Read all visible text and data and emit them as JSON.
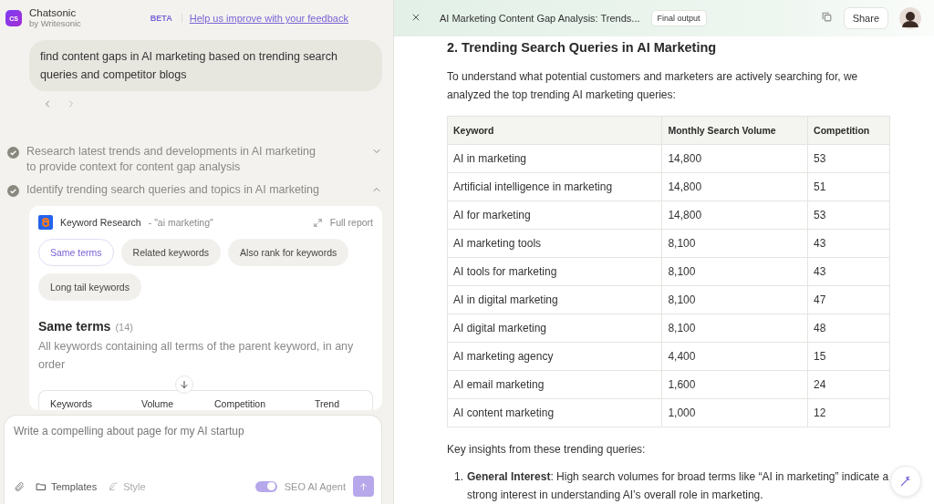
{
  "app": {
    "name": "Chatsonic",
    "byline": "by Writesonic",
    "logo": "CS",
    "badge": "BETA",
    "feedback_link": "Help us improve with your feedback"
  },
  "chat": {
    "user_message": "find content gaps in AI marketing based on trending search queries and competitor blogs",
    "steps": [
      {
        "text": "Research latest trends and developments in AI marketing to provide context for content gap analysis",
        "done": true,
        "expanded": false
      },
      {
        "text": "Identify trending search queries and topics in AI marketing",
        "done": true,
        "expanded": true
      }
    ],
    "tool_card": {
      "title": "Keyword Research",
      "query": "- \"ai marketing\"",
      "full_report": "Full report",
      "chips": [
        {
          "label": "Same terms",
          "selected": true
        },
        {
          "label": "Related keywords",
          "selected": false
        },
        {
          "label": "Also rank for keywords",
          "selected": false
        },
        {
          "label": "Long tail keywords",
          "selected": false
        }
      ],
      "section_title": "Same terms",
      "section_count": "(14)",
      "section_desc": "All keywords containing all terms of the parent keyword, in any order",
      "columns": [
        "Keywords",
        "Volume",
        "Competition",
        "Trend"
      ]
    }
  },
  "composer": {
    "placeholder": "Write a compelling about page for my AI startup",
    "templates": "Templates",
    "style": "Style",
    "agent_label": "SEO AI Agent",
    "agent_on": true
  },
  "document": {
    "title": "AI Marketing Content Gap Analysis: Trends...",
    "tag": "Final output",
    "share": "Share",
    "heading": "2. Trending Search Queries in AI Marketing",
    "intro": "To understand what potential customers and marketers are actively searching for, we analyzed the top trending AI marketing queries:",
    "table": {
      "columns": [
        "Keyword",
        "Monthly Search Volume",
        "Competition"
      ],
      "rows": [
        [
          "AI in marketing",
          "14,800",
          "53"
        ],
        [
          "Artificial intelligence in marketing",
          "14,800",
          "51"
        ],
        [
          "AI for marketing",
          "14,800",
          "53"
        ],
        [
          "AI marketing tools",
          "8,100",
          "43"
        ],
        [
          "AI tools for marketing",
          "8,100",
          "43"
        ],
        [
          "AI in digital marketing",
          "8,100",
          "47"
        ],
        [
          "AI digital marketing",
          "8,100",
          "48"
        ],
        [
          "AI marketing agency",
          "4,400",
          "15"
        ],
        [
          "AI email marketing",
          "1,600",
          "24"
        ],
        [
          "AI content marketing",
          "1,000",
          "12"
        ]
      ]
    },
    "insights_intro": "Key insights from these trending queries:",
    "insights": [
      {
        "number": "1.",
        "text": "**General Interest**: High search volumes for broad terms like “AI in marketing” indicate a strong interest in understanding AI’s overall role in marketing."
      }
    ]
  }
}
